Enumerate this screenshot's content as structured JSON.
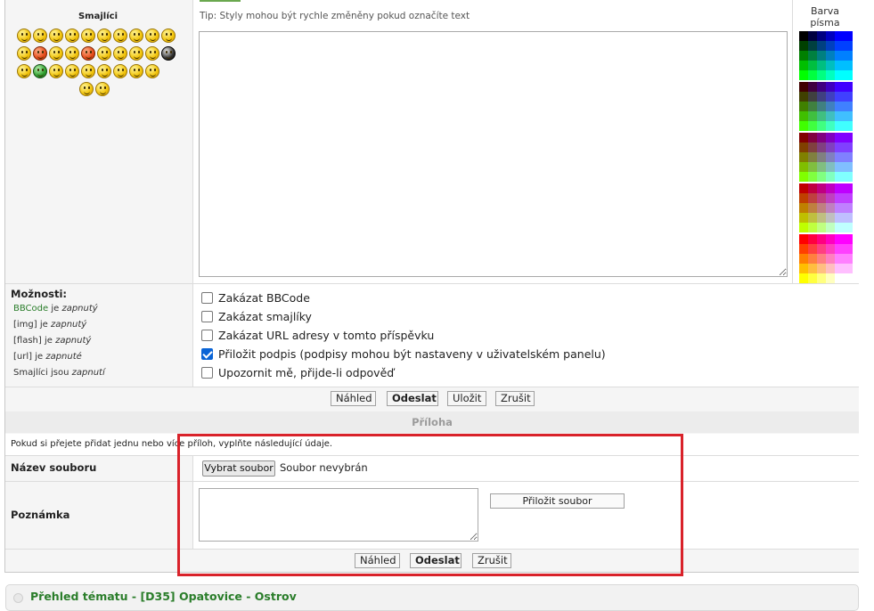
{
  "smilies": {
    "title": "Smajlíci",
    "items": [
      "smile",
      "tongue",
      "grin",
      "surprised",
      "confused",
      "cool",
      "sad",
      "laugh",
      "angry",
      "mad",
      "neutral",
      "cat",
      "devil",
      "wink",
      "exclamation",
      "question",
      "idea",
      "arrow",
      "smile",
      "green",
      "sick",
      "nerd",
      "gun",
      "happy",
      "snail",
      "sheep",
      "sly",
      "thumbs",
      "roll"
    ]
  },
  "editor": {
    "tip": "Tip: Styly mohou být rychle změněny pokud označíte text",
    "value": ""
  },
  "color_panel": {
    "title_line1": "Barva",
    "title_line2": "písma"
  },
  "options": {
    "title": "Možnosti:",
    "status": [
      {
        "name": "BBCode",
        "state": "zapnutý",
        "link": true
      },
      {
        "name": "[img] je",
        "state": "zapnutý",
        "link": false
      },
      {
        "name": "[flash] je",
        "state": "zapnutý",
        "link": false
      },
      {
        "name": "[url] je",
        "state": "zapnuté",
        "link": false
      },
      {
        "name": "Smajlíci jsou",
        "state": "zapnutí",
        "link": false
      }
    ],
    "bbcode_suffix": " je ",
    "checkboxes": [
      {
        "label": "Zakázat BBCode",
        "checked": false
      },
      {
        "label": "Zakázat smajlíky",
        "checked": false
      },
      {
        "label": "Zakázat URL adresy v tomto příspěvku",
        "checked": false
      },
      {
        "label": "Přiložit podpis (podpisy mohou být nastaveny v uživatelském panelu)",
        "checked": true
      },
      {
        "label": "Upozornit mě, přijde-li odpověď",
        "checked": false
      }
    ]
  },
  "buttons": {
    "preview": "Náhled",
    "submit": "Odeslat",
    "save": "Uložit",
    "cancel": "Zrušit"
  },
  "attachment": {
    "header": "Příloha",
    "note": "Pokud si přejete přidat jednu nebo více příloh, vyplňte následující údaje.",
    "filename_label": "Název souboru",
    "choose_file": "Vybrat soubor",
    "no_file": "Soubor nevybrán",
    "comment_label": "Poznámka",
    "attach_button": "Přiložit soubor"
  },
  "topic": {
    "title": "Přehled tématu - [D35] Opatovice - Ostrov"
  },
  "colors": {
    "accent_green": "#2a7d2a",
    "highlight_red": "#d9222a"
  }
}
